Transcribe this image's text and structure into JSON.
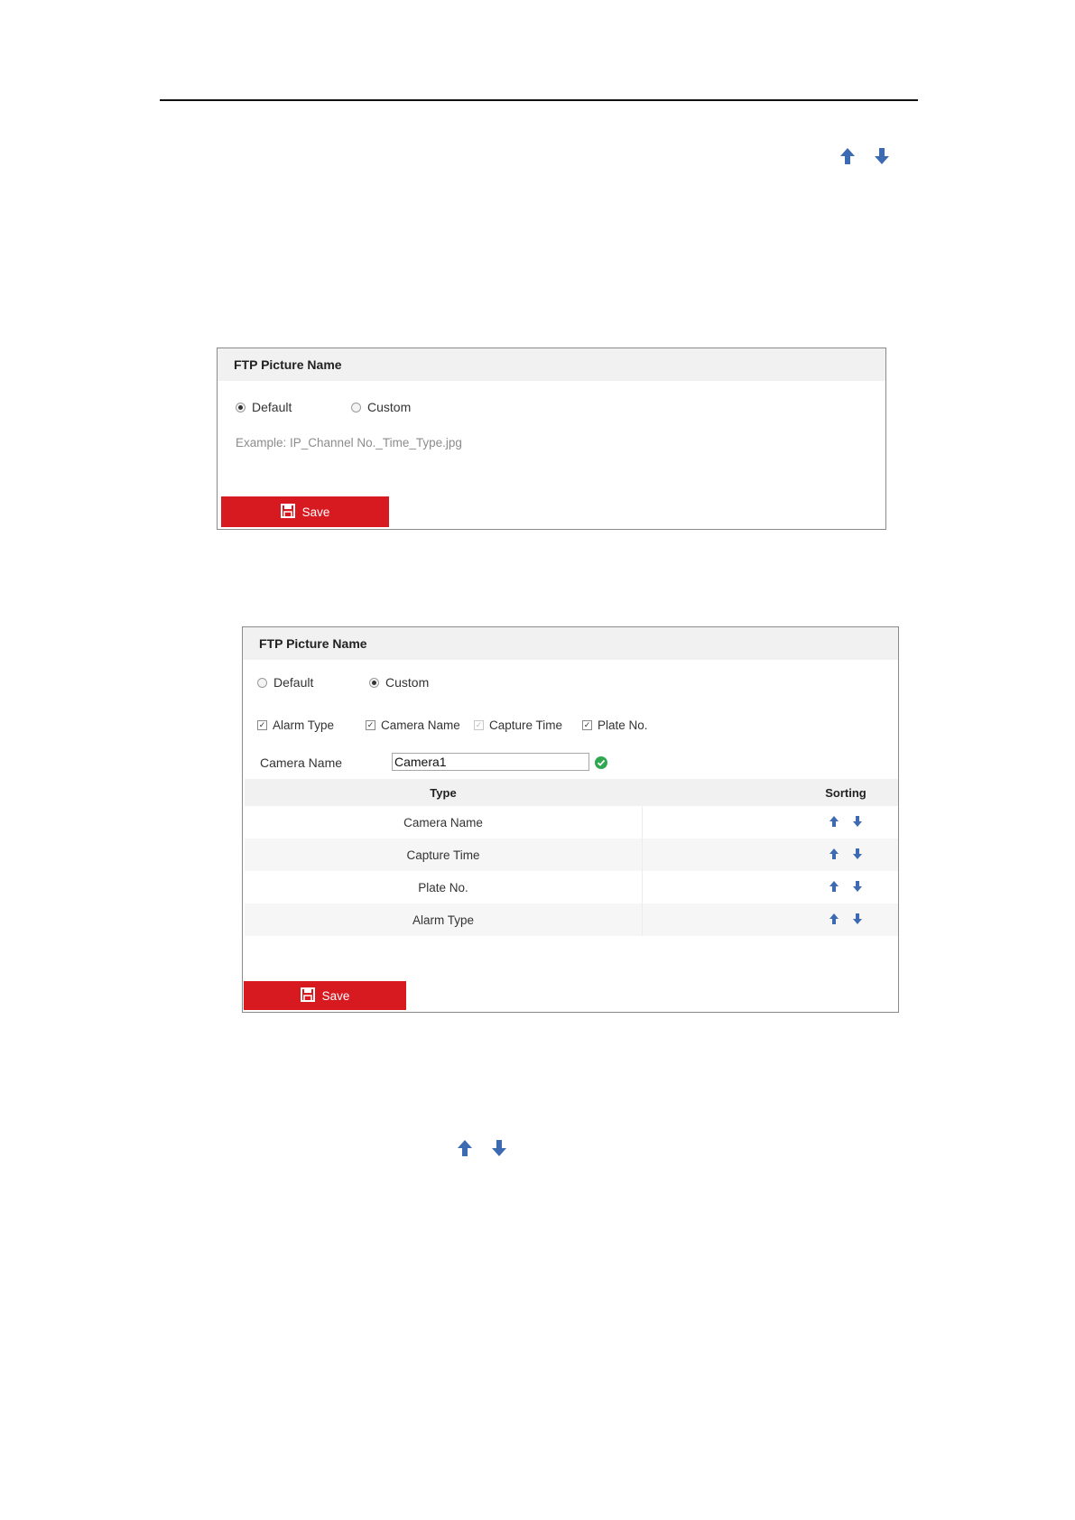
{
  "colors": {
    "accent": "#d71920",
    "arrow": "#3d6bb3",
    "ok": "#2fa84f"
  },
  "panel1": {
    "title": "FTP Picture Name",
    "radio_default": "Default",
    "radio_custom": "Custom",
    "selected": "Default",
    "example": "Example: IP_Channel No._Time_Type.jpg",
    "save_label": "Save"
  },
  "panel2": {
    "title": "FTP Picture Name",
    "radio_default": "Default",
    "radio_custom": "Custom",
    "selected": "Custom",
    "checkboxes": [
      {
        "label": "Alarm Type",
        "checked": true,
        "disabled": false
      },
      {
        "label": "Camera Name",
        "checked": true,
        "disabled": false
      },
      {
        "label": "Capture Time",
        "checked": true,
        "disabled": true
      },
      {
        "label": "Plate No.",
        "checked": true,
        "disabled": false
      }
    ],
    "camera_name_label": "Camera Name",
    "camera_name_value": "Camera1",
    "table": {
      "headers": {
        "type": "Type",
        "sorting": "Sorting"
      },
      "rows": [
        {
          "type": "Camera Name"
        },
        {
          "type": "Capture Time"
        },
        {
          "type": "Plate No."
        },
        {
          "type": "Alarm Type"
        }
      ]
    },
    "save_label": "Save"
  }
}
